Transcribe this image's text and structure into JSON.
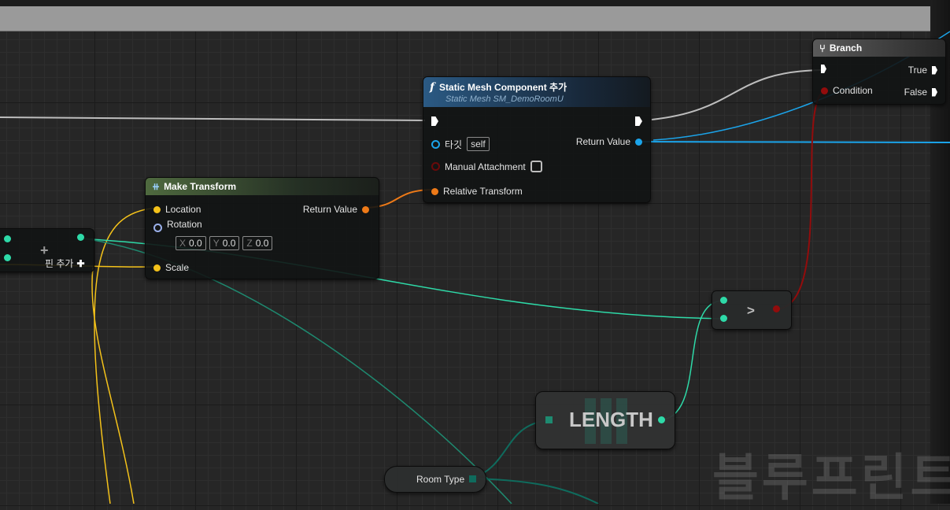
{
  "watermark": "블루프린트",
  "nodes": {
    "branch": {
      "title": "Branch",
      "pins": {
        "condition": "Condition",
        "true_out": "True",
        "false_out": "False"
      }
    },
    "add_static_mesh": {
      "title": "Static Mesh Component 추가",
      "subtitle": "Static Mesh SM_DemoRoomU",
      "pins": {
        "target": "타깃",
        "target_value": "self",
        "return_value": "Return Value",
        "manual_attachment": "Manual Attachment",
        "relative_transform": "Relative Transform"
      }
    },
    "make_transform": {
      "title": "Make Transform",
      "pins": {
        "location": "Location",
        "return_value": "Return Value",
        "rotation": "Rotation",
        "scale": "Scale",
        "rotation_x": {
          "axis": "X",
          "value": "0.0"
        },
        "rotation_y": {
          "axis": "Y",
          "value": "0.0"
        },
        "rotation_z": {
          "axis": "Z",
          "value": "0.0"
        }
      }
    },
    "make_array": {
      "plus_symbol": "+",
      "add_pin_label": "핀 추가",
      "add_pin_symbol": "✚"
    },
    "greater": {
      "op": ">"
    },
    "length": {
      "title": "LENGTH"
    },
    "room_type": {
      "label": "Room Type"
    }
  },
  "colors": {
    "exec": "#ffffff",
    "object": "#1ba4ea",
    "struct_transform": "#ee7a18",
    "vector": "#f4c21a",
    "rotator": "#9bb0ea",
    "bool": "#920c0c",
    "int_array": "#2edaa8",
    "header_function": "#2b5a84",
    "header_pure": "#4f6a3f",
    "header_branch": "#4a4a4a"
  }
}
